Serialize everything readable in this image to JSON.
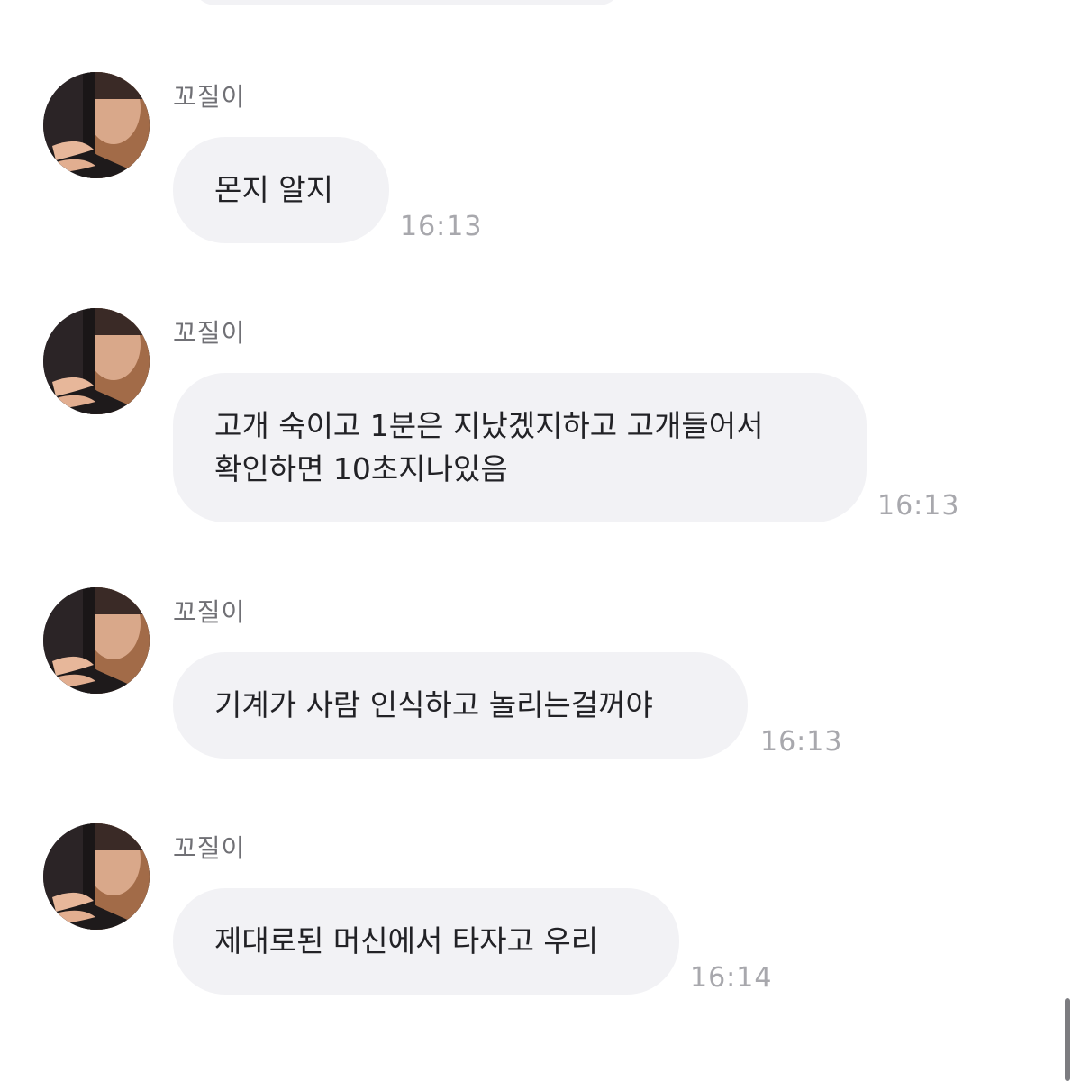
{
  "messages": [
    {
      "sender": "꼬질이",
      "text": "몬지 알지",
      "time": "16:13"
    },
    {
      "sender": "꼬질이",
      "text": "고개 숙이고 1분은 지났겠지하고 고개들어서\n확인하면 10초지나있음",
      "time": "16:13"
    },
    {
      "sender": "꼬질이",
      "text": "기계가 사람 인식하고 놀리는걸꺼야",
      "time": "16:13"
    },
    {
      "sender": "꼬질이",
      "text": "제대로된 머신에서 타자고 우리",
      "time": "16:14"
    }
  ],
  "colors": {
    "bubble": "#f2f2f5",
    "text": "#222226",
    "sender": "#707075",
    "timestamp": "#a8a8ad"
  }
}
